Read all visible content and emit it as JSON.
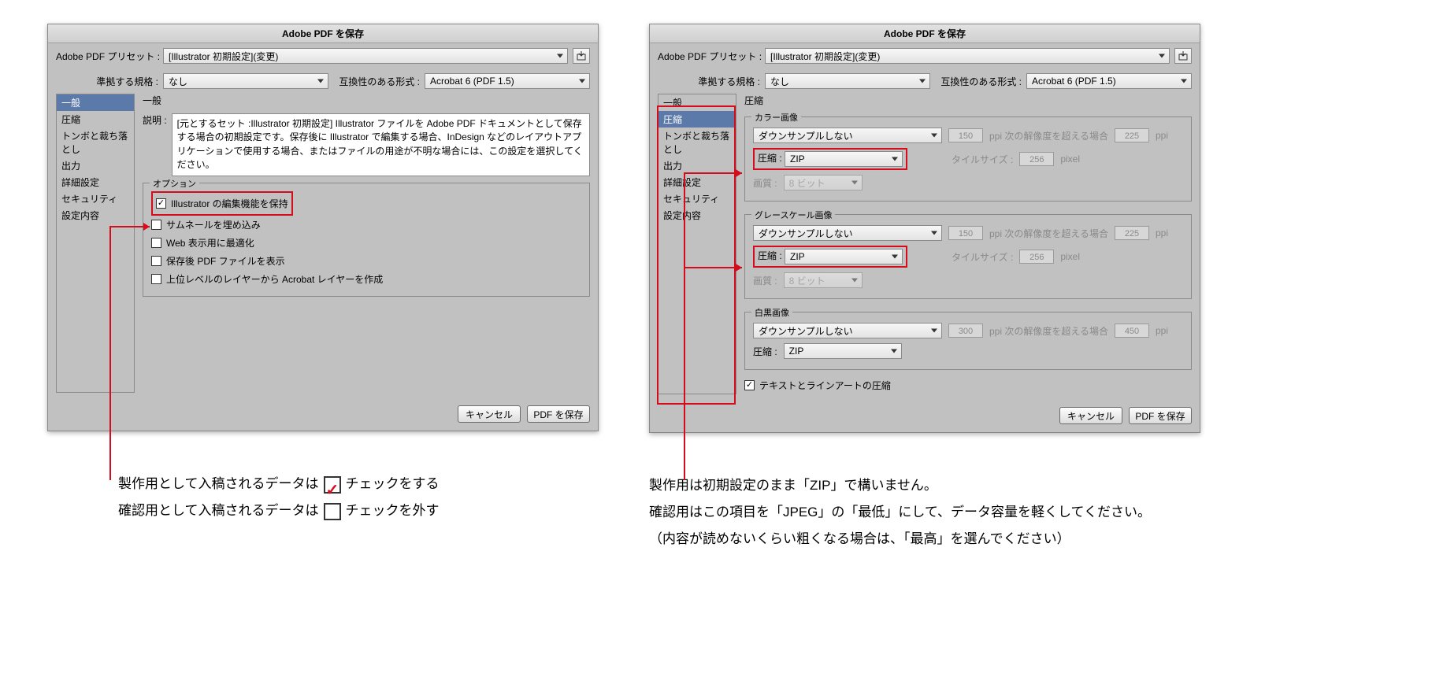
{
  "dialog_title": "Adobe PDF を保存",
  "preset_label": "Adobe PDF プリセット :",
  "preset_value": "[Illustrator 初期設定](変更)",
  "standard_label": "準拠する規格 :",
  "standard_value": "なし",
  "compat_label": "互換性のある形式 :",
  "compat_value": "Acrobat 6 (PDF 1.5)",
  "sidebar": {
    "items": [
      "一般",
      "圧縮",
      "トンボと裁ち落とし",
      "出力",
      "詳細設定",
      "セキュリティ",
      "設定内容"
    ]
  },
  "left": {
    "panel_title": "一般",
    "desc_label": "説明 :",
    "desc_text": "[元とするセット :Illustrator 初期設定] Illustrator ファイルを Adobe PDF ドキュメントとして保存する場合の初期設定です。保存後に Illustrator で編集する場合、InDesign などのレイアウトアプリケーションで使用する場合、またはファイルの用途が不明な場合には、この設定を選択してください。",
    "options_legend": "オプション",
    "opts": [
      {
        "label": "Illustrator の編集機能を保持",
        "checked": true
      },
      {
        "label": "サムネールを埋め込み",
        "checked": false
      },
      {
        "label": "Web 表示用に最適化",
        "checked": false
      },
      {
        "label": "保存後 PDF ファイルを表示",
        "checked": false
      },
      {
        "label": "上位レベルのレイヤーから Acrobat レイヤーを作成",
        "checked": false
      }
    ]
  },
  "right": {
    "panel_title": "圧縮",
    "groups": [
      {
        "legend": "カラー画像",
        "downsample": "ダウンサンプルしない",
        "ppi1": "150",
        "ppi2": "225",
        "compress": "ZIP",
        "tile": "256",
        "quality": "8 ビット"
      },
      {
        "legend": "グレースケール画像",
        "downsample": "ダウンサンプルしない",
        "ppi1": "150",
        "ppi2": "225",
        "compress": "ZIP",
        "tile": "256",
        "quality": "8 ビット"
      },
      {
        "legend": "白黒画像",
        "downsample": "ダウンサンプルしない",
        "ppi1": "300",
        "ppi2": "450",
        "compress": "ZIP"
      }
    ],
    "ppi_text_a": "ppi 次の解像度を超える場合",
    "ppi_text_b": "ppi",
    "compress_label": "圧縮 :",
    "tile_label": "タイルサイズ :",
    "pixel": "pixel",
    "quality_label": "画質 :",
    "text_lineart": "テキストとラインアートの圧縮"
  },
  "buttons": {
    "cancel": "キャンセル",
    "save": "PDF を保存"
  },
  "captions": {
    "left1a": "製作用として入稿されるデータは",
    "left1b": "チェックをする",
    "left2a": "確認用として入稿されるデータは",
    "left2b": "チェックを外す",
    "right1": "製作用は初期設定のまま「ZIP」で構いません。",
    "right2": "確認用はこの項目を「JPEG」の「最低」にして、データ容量を軽くしてください。",
    "right3": "（内容が読めないくらい粗くなる場合は、「最高」を選んでください）"
  }
}
